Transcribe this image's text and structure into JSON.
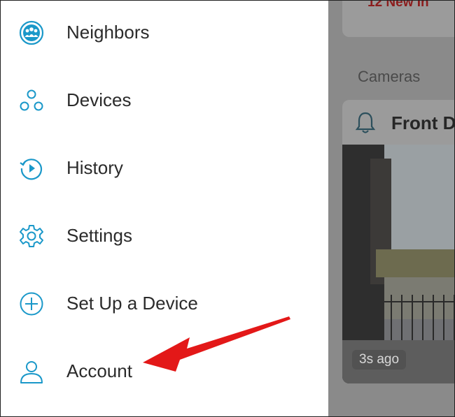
{
  "drawer": {
    "items": [
      {
        "label": "Neighbors",
        "icon": "neighbors-icon"
      },
      {
        "label": "Devices",
        "icon": "devices-icon"
      },
      {
        "label": "History",
        "icon": "history-icon"
      },
      {
        "label": "Settings",
        "icon": "gear-icon"
      },
      {
        "label": "Set Up a Device",
        "icon": "plus-circle-icon"
      },
      {
        "label": "Account",
        "icon": "user-icon"
      }
    ]
  },
  "background_app": {
    "notification_text": "12 New In",
    "section_label": "Cameras",
    "camera": {
      "title": "Front D",
      "time_badge": "3s ago"
    }
  },
  "colors": {
    "icon_accent": "#1a98c9",
    "annotation_arrow": "#e31818",
    "notification_text": "#8c1d1d"
  }
}
